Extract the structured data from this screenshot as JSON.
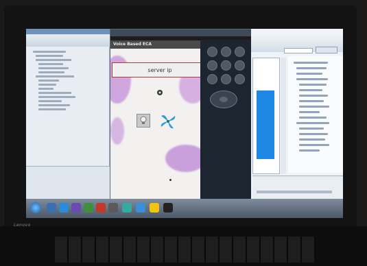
{
  "device": {
    "brand": "Lenovo"
  },
  "emulator": {
    "app_title": "Voice Based ECA",
    "server_box_text": "server ip"
  },
  "colors": {
    "screen_bg": "#cfd9e3",
    "ide_blue": "#1e86e3",
    "emu_dark": "#1d2530",
    "server_border": "#b23a3a",
    "taskbar": "#4b5866"
  },
  "icons": [
    "gear-icon",
    "bulb-icon",
    "fan-icon",
    "windows-start-icon"
  ]
}
